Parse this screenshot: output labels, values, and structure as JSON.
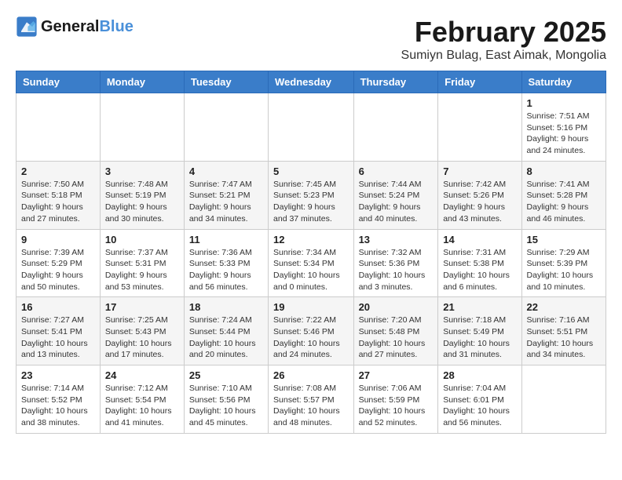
{
  "header": {
    "logo_line1": "General",
    "logo_line2": "Blue",
    "month": "February 2025",
    "location": "Sumiyn Bulag, East Aimak, Mongolia"
  },
  "weekdays": [
    "Sunday",
    "Monday",
    "Tuesday",
    "Wednesday",
    "Thursday",
    "Friday",
    "Saturday"
  ],
  "weeks": [
    [
      {
        "day": "",
        "info": ""
      },
      {
        "day": "",
        "info": ""
      },
      {
        "day": "",
        "info": ""
      },
      {
        "day": "",
        "info": ""
      },
      {
        "day": "",
        "info": ""
      },
      {
        "day": "",
        "info": ""
      },
      {
        "day": "1",
        "info": "Sunrise: 7:51 AM\nSunset: 5:16 PM\nDaylight: 9 hours and 24 minutes."
      }
    ],
    [
      {
        "day": "2",
        "info": "Sunrise: 7:50 AM\nSunset: 5:18 PM\nDaylight: 9 hours and 27 minutes."
      },
      {
        "day": "3",
        "info": "Sunrise: 7:48 AM\nSunset: 5:19 PM\nDaylight: 9 hours and 30 minutes."
      },
      {
        "day": "4",
        "info": "Sunrise: 7:47 AM\nSunset: 5:21 PM\nDaylight: 9 hours and 34 minutes."
      },
      {
        "day": "5",
        "info": "Sunrise: 7:45 AM\nSunset: 5:23 PM\nDaylight: 9 hours and 37 minutes."
      },
      {
        "day": "6",
        "info": "Sunrise: 7:44 AM\nSunset: 5:24 PM\nDaylight: 9 hours and 40 minutes."
      },
      {
        "day": "7",
        "info": "Sunrise: 7:42 AM\nSunset: 5:26 PM\nDaylight: 9 hours and 43 minutes."
      },
      {
        "day": "8",
        "info": "Sunrise: 7:41 AM\nSunset: 5:28 PM\nDaylight: 9 hours and 46 minutes."
      }
    ],
    [
      {
        "day": "9",
        "info": "Sunrise: 7:39 AM\nSunset: 5:29 PM\nDaylight: 9 hours and 50 minutes."
      },
      {
        "day": "10",
        "info": "Sunrise: 7:37 AM\nSunset: 5:31 PM\nDaylight: 9 hours and 53 minutes."
      },
      {
        "day": "11",
        "info": "Sunrise: 7:36 AM\nSunset: 5:33 PM\nDaylight: 9 hours and 56 minutes."
      },
      {
        "day": "12",
        "info": "Sunrise: 7:34 AM\nSunset: 5:34 PM\nDaylight: 10 hours and 0 minutes."
      },
      {
        "day": "13",
        "info": "Sunrise: 7:32 AM\nSunset: 5:36 PM\nDaylight: 10 hours and 3 minutes."
      },
      {
        "day": "14",
        "info": "Sunrise: 7:31 AM\nSunset: 5:38 PM\nDaylight: 10 hours and 6 minutes."
      },
      {
        "day": "15",
        "info": "Sunrise: 7:29 AM\nSunset: 5:39 PM\nDaylight: 10 hours and 10 minutes."
      }
    ],
    [
      {
        "day": "16",
        "info": "Sunrise: 7:27 AM\nSunset: 5:41 PM\nDaylight: 10 hours and 13 minutes."
      },
      {
        "day": "17",
        "info": "Sunrise: 7:25 AM\nSunset: 5:43 PM\nDaylight: 10 hours and 17 minutes."
      },
      {
        "day": "18",
        "info": "Sunrise: 7:24 AM\nSunset: 5:44 PM\nDaylight: 10 hours and 20 minutes."
      },
      {
        "day": "19",
        "info": "Sunrise: 7:22 AM\nSunset: 5:46 PM\nDaylight: 10 hours and 24 minutes."
      },
      {
        "day": "20",
        "info": "Sunrise: 7:20 AM\nSunset: 5:48 PM\nDaylight: 10 hours and 27 minutes."
      },
      {
        "day": "21",
        "info": "Sunrise: 7:18 AM\nSunset: 5:49 PM\nDaylight: 10 hours and 31 minutes."
      },
      {
        "day": "22",
        "info": "Sunrise: 7:16 AM\nSunset: 5:51 PM\nDaylight: 10 hours and 34 minutes."
      }
    ],
    [
      {
        "day": "23",
        "info": "Sunrise: 7:14 AM\nSunset: 5:52 PM\nDaylight: 10 hours and 38 minutes."
      },
      {
        "day": "24",
        "info": "Sunrise: 7:12 AM\nSunset: 5:54 PM\nDaylight: 10 hours and 41 minutes."
      },
      {
        "day": "25",
        "info": "Sunrise: 7:10 AM\nSunset: 5:56 PM\nDaylight: 10 hours and 45 minutes."
      },
      {
        "day": "26",
        "info": "Sunrise: 7:08 AM\nSunset: 5:57 PM\nDaylight: 10 hours and 48 minutes."
      },
      {
        "day": "27",
        "info": "Sunrise: 7:06 AM\nSunset: 5:59 PM\nDaylight: 10 hours and 52 minutes."
      },
      {
        "day": "28",
        "info": "Sunrise: 7:04 AM\nSunset: 6:01 PM\nDaylight: 10 hours and 56 minutes."
      },
      {
        "day": "",
        "info": ""
      }
    ]
  ]
}
